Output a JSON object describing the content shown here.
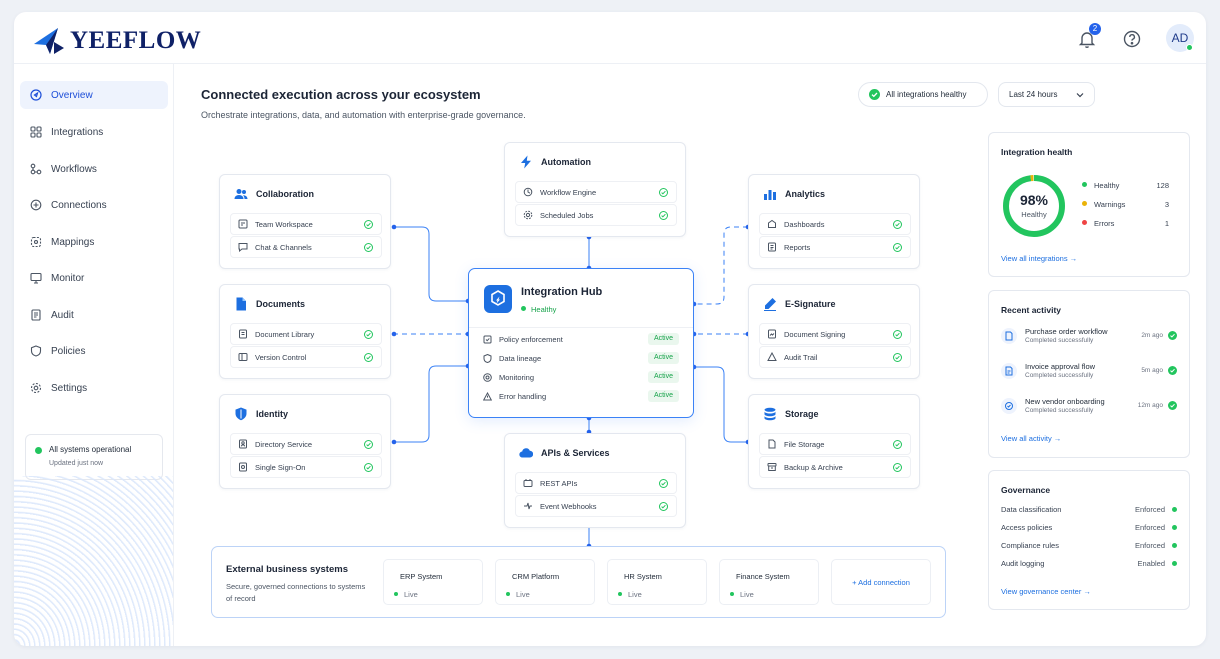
{
  "app": {
    "brand": "YEEFLOW",
    "notification_count": "2",
    "avatar_initials": "AD"
  },
  "colors": {
    "accent": "#1d6fe0",
    "healthy": "#22c55e",
    "warning": "#eab308",
    "error": "#ef4444"
  },
  "sidebar": {
    "items": [
      {
        "label": "Overview",
        "icon": "overview-icon",
        "active": true
      },
      {
        "label": "Integrations",
        "icon": "integrations-icon"
      },
      {
        "label": "Workflows",
        "icon": "workflows-icon"
      },
      {
        "label": "Connections",
        "icon": "connections-icon"
      },
      {
        "label": "Mappings",
        "icon": "mappings-icon"
      },
      {
        "label": "Monitor",
        "icon": "monitor-icon"
      },
      {
        "label": "Audit",
        "icon": "audit-icon"
      },
      {
        "label": "Policies",
        "icon": "policies-icon"
      },
      {
        "label": "Settings",
        "icon": "settings-icon"
      }
    ],
    "status": {
      "title": "All systems operational",
      "subtitle": "Updated just now"
    }
  },
  "main": {
    "title": "Connected execution across your ecosystem",
    "subtitle": "Orchestrate integrations, data, and automation with enterprise-grade governance.",
    "health_pill": "All integrations healthy",
    "time_range": "Last 24 hours"
  },
  "cards": {
    "collaboration": {
      "title": "Collaboration",
      "rows": [
        "Team Workspace",
        "Chat & Channels"
      ]
    },
    "documents": {
      "title": "Documents",
      "rows": [
        "Document Library",
        "Version Control"
      ]
    },
    "identity": {
      "title": "Identity",
      "rows": [
        "Directory Service",
        "Single Sign-On"
      ]
    },
    "automation": {
      "title": "Automation",
      "rows": [
        "Workflow Engine",
        "Scheduled Jobs"
      ]
    },
    "apis": {
      "title": "APIs & Services",
      "rows": [
        "REST APIs",
        "Event Webhooks"
      ]
    },
    "analytics": {
      "title": "Analytics",
      "rows": [
        "Dashboards",
        "Reports"
      ]
    },
    "esignature": {
      "title": "E-Signature",
      "rows": [
        "Document Signing",
        "Audit Trail"
      ]
    },
    "storage": {
      "title": "Storage",
      "rows": [
        "File Storage",
        "Backup & Archive"
      ]
    }
  },
  "hub": {
    "title": "Integration Hub",
    "status": "Healthy",
    "rows": [
      {
        "label": "Policy enforcement",
        "tag": "Active"
      },
      {
        "label": "Data lineage",
        "tag": "Active"
      },
      {
        "label": "Monitoring",
        "tag": "Active"
      },
      {
        "label": "Error handling",
        "tag": "Active"
      }
    ]
  },
  "external": {
    "title": "External business systems",
    "subtitle": "Secure, governed connections to systems of record",
    "systems": [
      {
        "name": "ERP System",
        "status": "Live"
      },
      {
        "name": "CRM Platform",
        "status": "Live"
      },
      {
        "name": "HR System",
        "status": "Live"
      },
      {
        "name": "Finance System",
        "status": "Live"
      }
    ],
    "add_label": "+ Add connection"
  },
  "health": {
    "title": "Integration health",
    "percent_label": "98%",
    "percent_value": 98,
    "center_label": "Healthy",
    "legend": [
      {
        "label": "Healthy",
        "value": "128",
        "color": "#22c55e"
      },
      {
        "label": "Warnings",
        "value": "3",
        "color": "#eab308"
      },
      {
        "label": "Errors",
        "value": "1",
        "color": "#ef4444"
      }
    ],
    "link": "View all integrations →"
  },
  "activity": {
    "title": "Recent activity",
    "items": [
      {
        "title": "Purchase order workflow",
        "status": "Completed successfully",
        "time": "2m ago"
      },
      {
        "title": "Invoice approval flow",
        "status": "Completed successfully",
        "time": "5m ago"
      },
      {
        "title": "New vendor onboarding",
        "status": "Completed successfully",
        "time": "12m ago"
      }
    ],
    "link": "View all activity →"
  },
  "governance": {
    "title": "Governance",
    "items": [
      {
        "label": "Data classification",
        "value": "Enforced"
      },
      {
        "label": "Access policies",
        "value": "Enforced"
      },
      {
        "label": "Compliance rules",
        "value": "Enforced"
      },
      {
        "label": "Audit logging",
        "value": "Enabled"
      }
    ],
    "link": "View governance center →"
  }
}
